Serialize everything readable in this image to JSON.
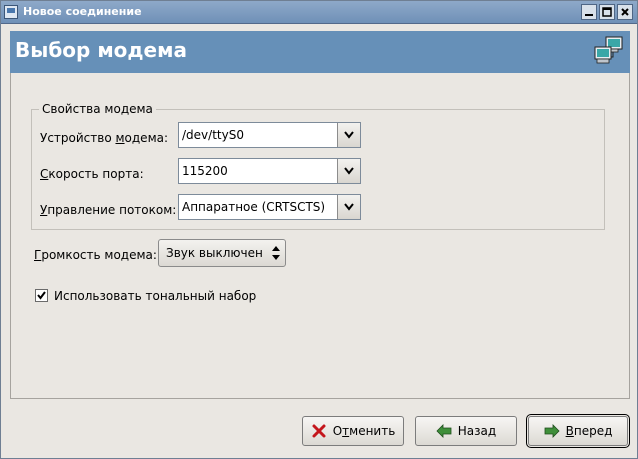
{
  "window": {
    "title": "Новое соединение"
  },
  "banner": {
    "title": "Выбор модема",
    "icon": "network-computers-icon"
  },
  "modem_props": {
    "legend": "Свойства модема",
    "device": {
      "label_pre": "Устройство ",
      "label_u": "м",
      "label_post": "одема:",
      "value": "/dev/ttyS0"
    },
    "speed": {
      "label_pre": "",
      "label_u": "С",
      "label_post": "корость порта:",
      "value": "115200"
    },
    "flow": {
      "label_pre": "",
      "label_u": "У",
      "label_post": "правление потоком:",
      "value": "Аппаратное (CRTSCTS)"
    }
  },
  "volume": {
    "label_pre": "",
    "label_u": "Г",
    "label_post": "ромкость модема:",
    "value": "Звук выключен"
  },
  "touch_tone": {
    "label": "Использовать тональный набор",
    "checked": true
  },
  "buttons": {
    "cancel": {
      "pre": "О",
      "u": "т",
      "post": "менить"
    },
    "back": {
      "label": "Назад"
    },
    "forward": {
      "pre": "",
      "u": "В",
      "post": "перед"
    }
  },
  "colors": {
    "banner": "#6690b8",
    "titlebar": "#7a98bd"
  }
}
